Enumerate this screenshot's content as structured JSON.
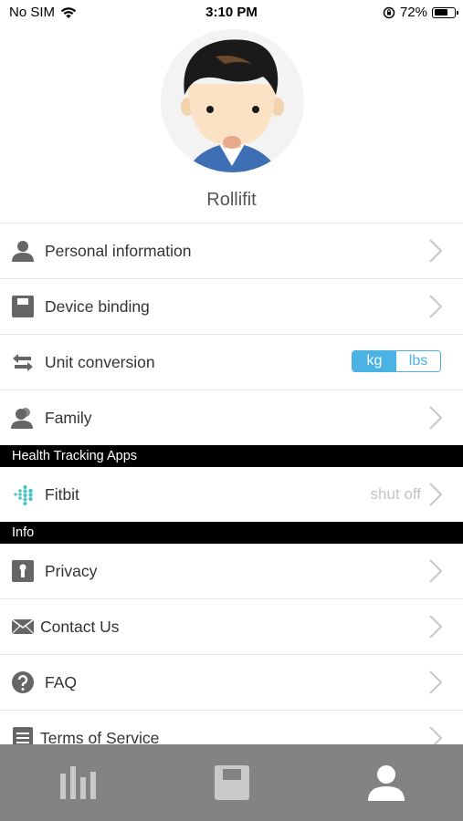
{
  "status_bar": {
    "carrier": "No SIM",
    "time": "3:10 PM",
    "battery_percent": "72%",
    "battery_level": 0.72
  },
  "profile": {
    "username": "Rollifit"
  },
  "menu": {
    "personal_information": "Personal information",
    "device_binding": "Device binding",
    "unit_conversion": "Unit conversion",
    "unit_options": [
      "kg",
      "lbs"
    ],
    "unit_selected": "kg",
    "family": "Family"
  },
  "health_apps": {
    "header": "Health Tracking Apps",
    "fitbit_label": "Fitbit",
    "fitbit_status": "shut off"
  },
  "info": {
    "header": "Info",
    "privacy": "Privacy",
    "contact_us": "Contact Us",
    "faq": "FAQ",
    "terms_of_service": "Terms of Service"
  },
  "tab_bar": {
    "tabs": [
      "bar-chart-icon",
      "scale-icon",
      "person-icon"
    ],
    "active_tab": "person-icon"
  },
  "colors": {
    "accent": "#4bb3e3",
    "tab_bar_bg": "#838383",
    "fitbit": "#4cc2c4"
  }
}
